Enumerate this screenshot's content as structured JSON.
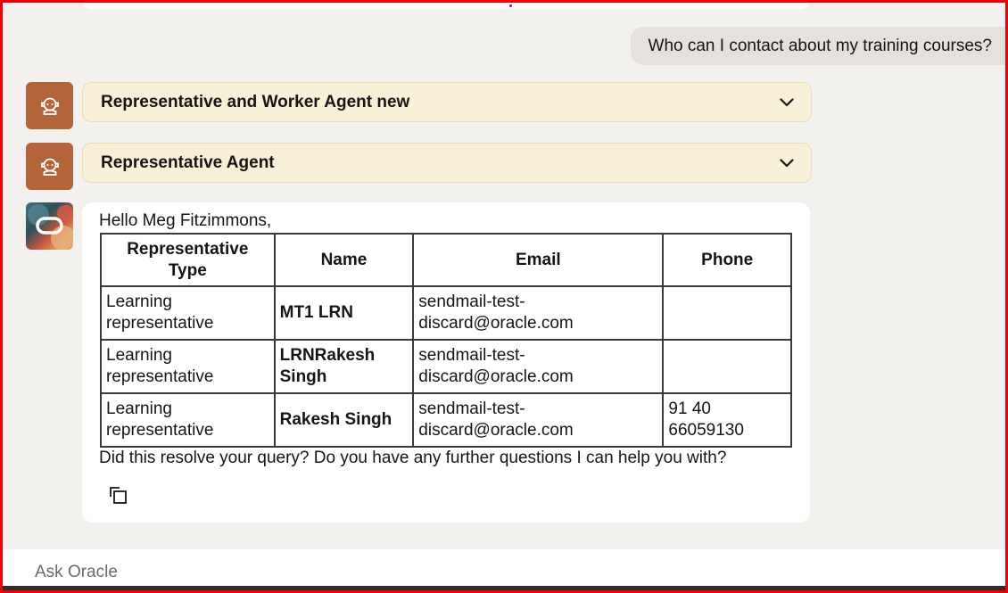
{
  "conversation": {
    "user_message": "Who can I contact about my training courses?",
    "agents": [
      {
        "label": "Representative and Worker Agent new",
        "icon": "agent-robot-icon"
      },
      {
        "label": "Representative Agent",
        "icon": "agent-robot-icon"
      }
    ],
    "answer": {
      "greeting": "Hello Meg Fitzimmons,",
      "table": {
        "headers": [
          "Representative Type",
          "Name",
          "Email",
          "Phone"
        ],
        "rows": [
          [
            "Learning representative",
            "MT1 LRN",
            "sendmail-test-discard@oracle.com",
            ""
          ],
          [
            "Learning representative",
            "LRNRakesh Singh",
            "sendmail-test-discard@oracle.com",
            ""
          ],
          [
            "Learning representative",
            "Rakesh Singh",
            "sendmail-test-discard@oracle.com",
            "91 40 66059130"
          ]
        ]
      },
      "followup": "Did this resolve your query? Do you have any further questions I can help you with?",
      "copy_icon": "copy-icon"
    }
  },
  "input": {
    "placeholder": "Ask Oracle",
    "value": ""
  },
  "colors": {
    "frame": "#e8000b",
    "agent_avatar": "#b3643a",
    "agent_bar": "#f8efd7",
    "user_bubble": "#e5e1dc",
    "background": "#f3f1ee"
  }
}
